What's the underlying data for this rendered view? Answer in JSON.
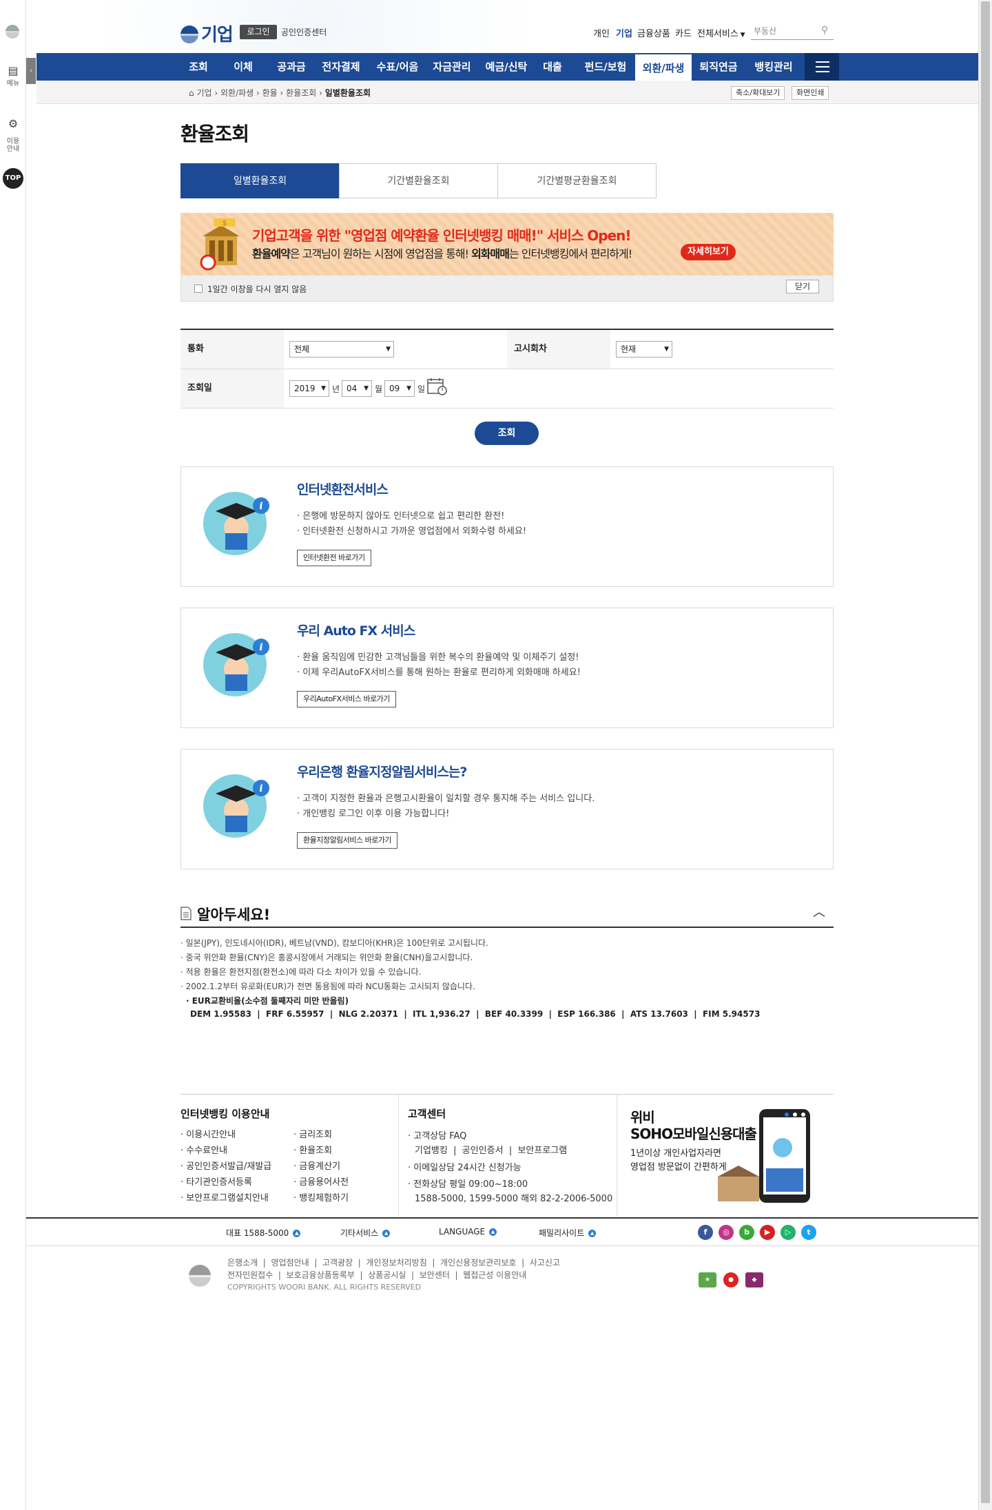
{
  "rail": {
    "menu_label": "메뉴",
    "guide_label": "이용\n안내",
    "top_label": "TOP"
  },
  "header": {
    "brand": "기업",
    "login": "로그인",
    "cert": "공인인증센터",
    "util": [
      "개인",
      "기업",
      "금융상품",
      "카드",
      "전체서비스"
    ],
    "search_placeholder": "부동산"
  },
  "gnb": {
    "items": [
      "조회",
      "이체",
      "공과금",
      "전자결제",
      "수표/어음",
      "자금관리",
      "예금/신탁",
      "대출",
      "펀드/보험",
      "외환/파생",
      "퇴직연금",
      "뱅킹관리"
    ],
    "active_index": 9
  },
  "breadcrumb": {
    "items": [
      "기업",
      "외환/파생",
      "환율",
      "환율조회",
      "일별환율조회"
    ],
    "zoom_btn": "축소/확대보기",
    "print_btn": "화면인쇄"
  },
  "page_title": "환율조회",
  "tabs": [
    "일별환율조회",
    "기간별환율조회",
    "기간별평균환율조회"
  ],
  "banner": {
    "title": "기업고객을 위한 \"영업점 예약환율 인터넷뱅킹 매매!\" 서비스 Open!",
    "sub_a": "환율예약",
    "sub_b": "은 고객님이 원하는 시점에 영업점을 통해! ",
    "sub_c": "외화매매",
    "sub_d": "는 인터넷뱅킹에서 편리하게!",
    "detail_btn": "자세히보기",
    "nosee_label": "1일간 이창을 다시 열지 않음",
    "close_btn": "닫기"
  },
  "form": {
    "currency_label": "통화",
    "currency_value": "전체",
    "notice_round_label": "고시회차",
    "notice_round_value": "현재",
    "date_label": "조회일",
    "year": "2019",
    "year_unit": "년",
    "month": "04",
    "month_unit": "월",
    "day": "09",
    "day_unit": "일",
    "submit": "조회"
  },
  "services": [
    {
      "title": "인터넷환전서비스",
      "lines": [
        "· 은행에 방문하지 않아도 인터넷으로 쉽고 편리한 환전!",
        "· 인터넷환전 신청하시고 가까운 영업점에서 외화수령 하세요!"
      ],
      "button": "인터넷환전 바로가기"
    },
    {
      "title": "우리 Auto FX 서비스",
      "lines": [
        "· 환율 움직임에 민감한 고객님들을 위한 복수의 환율예약 및 이체주기 설정!",
        "· 이제 우리AutoFX서비스를 통해 원하는 환율로 편리하게 외화매매 하세요!"
      ],
      "button": "우리AutoFX서비스 바로가기"
    },
    {
      "title": "우리은행 환율지정알림서비스는?",
      "lines": [
        "· 고객이 지정한 환율과 은행고시환율이 일치할 경우 통지해 주는 서비스 입니다.",
        "· 개인뱅킹 로그인 이후 이용 가능합니다!"
      ],
      "button": "환율지정알림서비스 바로가기"
    }
  ],
  "notice": {
    "title": "알아두세요!",
    "items": [
      "· 일본(JPY), 인도네시아(IDR), 베트남(VND), 캄보디아(KHR)은 100단위로 고시됩니다.",
      "· 중국 위안화 환율(CNY)은 홍콩시장에서 거래되는 위안화 환율(CNH)을고시합니다.",
      "· 적용 환율은 환전지점(환전소)에 따라 다소 차이가 있을 수 있습니다.",
      "· 2002.1.2부터 유로화(EUR)가 전면 통용됨에 따라 NCU통화는 고시되지 않습니다."
    ],
    "eur_title": "· EUR교환비율(소수점 둘째자리 미만 반올림)",
    "eur_rates": "DEM 1.95583  |  FRF 6.55957  |  NLG 2.20371  |  ITL 1,936.27  |  BEF 40.3399  |  ESP 166.386  |  ATS 13.7603  |  FIM 5.94573"
  },
  "footer": {
    "guide_title": "인터넷뱅킹 이용안내",
    "guide_col1": [
      "· 이용시간안내",
      "· 수수료안내",
      "· 공인인증서발급/재발급",
      "· 타기관인증서등록",
      "· 보안프로그램설치안내"
    ],
    "guide_col2": [
      "· 금리조회",
      "· 환율조회",
      "· 금융계산기",
      "· 금융용어사전",
      "· 뱅킹체험하기"
    ],
    "cs_title": "고객센터",
    "cs_faq": "· 고객상담 FAQ",
    "cs_faq_links": "기업뱅킹  |  공인인증서  |  보안프로그램",
    "cs_email": "· 이메일상담 24시간 신청가능",
    "cs_phone": "· 전화상담 평일 09:00~18:00",
    "cs_phone_nums": "1588-5000, 1599-5000 해외 82-2-2006-5000",
    "promo_title_1": "위비",
    "promo_title_2": "SOHO모바일신용대출",
    "promo_sub_1": "1년이상 개인사업자라면",
    "promo_sub_2": "영업점 방문없이 간편하게",
    "bar": [
      "대표 1588-5000",
      "기타서비스",
      "LANGUAGE",
      "패밀리사이트"
    ],
    "links_1": "은행소개  |  영업점안내  |  고객광장  |  개인정보처리방침  |  개인신용정보관리보호  |  사고신고",
    "links_2": "전자민원접수  |  보호금융상품등록부  |  상품공시실  |  보안센터  |  웹접근성 이용안내",
    "copyright": "COPYRIGHTS WOORI BANK. ALL RIGHTS RESERVED"
  },
  "colors": {
    "brand_blue": "#1c4a94",
    "accent_red": "#e0291a"
  }
}
